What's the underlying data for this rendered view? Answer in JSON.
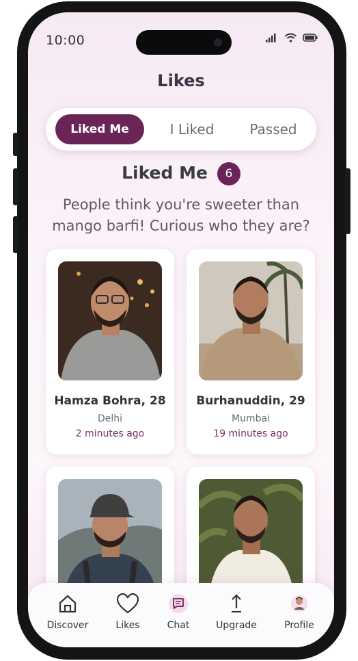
{
  "status_bar": {
    "time": "10:00"
  },
  "header": {
    "title": "Likes"
  },
  "tabs": [
    {
      "label": "Liked Me",
      "active": true
    },
    {
      "label": "I Liked",
      "active": false
    },
    {
      "label": "Passed",
      "active": false
    }
  ],
  "section": {
    "title": "Liked Me",
    "count": "6",
    "subtitle": "People think you're sweeter than mango barfi! Curious who they are?"
  },
  "profiles": [
    {
      "name": "Hamza Bohra, 28",
      "city": "Delhi",
      "time_ago": "2 minutes ago"
    },
    {
      "name": "Burhanuddin, 29",
      "city": "Mumbai",
      "time_ago": "19 minutes ago"
    },
    {
      "name": "",
      "city": "",
      "time_ago": ""
    },
    {
      "name": "",
      "city": "",
      "time_ago": ""
    }
  ],
  "bottom_nav": [
    {
      "label": "Discover",
      "icon": "home-icon"
    },
    {
      "label": "Likes",
      "icon": "heart-icon"
    },
    {
      "label": "Chat",
      "icon": "chat-icon"
    },
    {
      "label": "Upgrade",
      "icon": "upgrade-arrow-icon"
    },
    {
      "label": "Profile",
      "icon": "profile-avatar-icon"
    }
  ],
  "colors": {
    "accent": "#6a2457",
    "time_ago": "#7a2f6a",
    "background": "#f6e9f3"
  }
}
